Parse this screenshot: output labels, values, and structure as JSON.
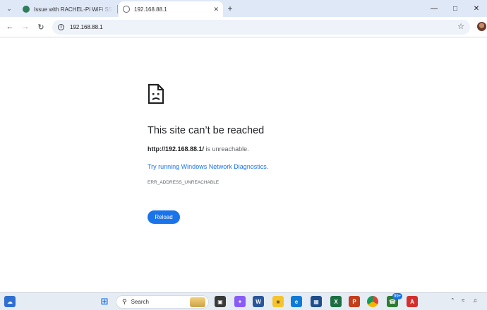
{
  "browser": {
    "tabs": [
      {
        "title": "Issue with RACHEL-Pi WiFi SSID",
        "active": false
      },
      {
        "title": "192.168.88.1",
        "active": true
      }
    ],
    "address": "192.168.88.1"
  },
  "error_page": {
    "title": "This site can’t be reached",
    "url_bold": "http://192.168.88.1/",
    "desc_suffix": " is unreachable.",
    "diagnostics_link": "Try running Windows Network Diagnostics.",
    "error_code": "ERR_ADDRESS_UNREACHABLE",
    "reload_label": "Reload"
  },
  "taskbar": {
    "search_placeholder": "Search",
    "notification_badge": "99+"
  },
  "colors": {
    "accent": "#1a73e8",
    "tabstrip": "#dfe8f7",
    "omnibox": "#eef2f9"
  }
}
